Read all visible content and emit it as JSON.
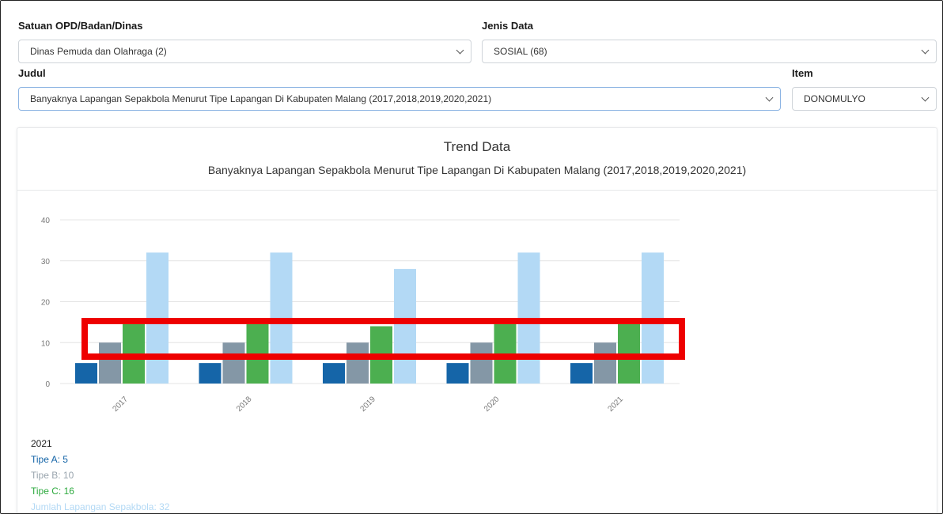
{
  "filters": {
    "satuan_label": "Satuan OPD/Badan/Dinas",
    "satuan_value": "Dinas Pemuda dan Olahraga (2)",
    "jenis_label": "Jenis Data",
    "jenis_value": "SOSIAL (68)",
    "judul_label": "Judul",
    "judul_value": "Banyaknya Lapangan Sepakbola Menurut Tipe Lapangan Di Kabupaten Malang (2017,2018,2019,2020,2021)",
    "item_label": "Item",
    "item_value": "DONOMULYO"
  },
  "card": {
    "title": "Trend Data",
    "subtitle": "Banyaknya Lapangan Sepakbola Menurut Tipe Lapangan Di Kabupaten Malang (2017,2018,2019,2020,2021)"
  },
  "chart_data": {
    "type": "bar",
    "categories": [
      "2017",
      "2018",
      "2019",
      "2020",
      "2021"
    ],
    "series": [
      {
        "name": "Tipe A",
        "values": [
          5,
          5,
          5,
          5,
          5
        ],
        "color": "#1565a8"
      },
      {
        "name": "Tipe B",
        "values": [
          10,
          10,
          10,
          10,
          10
        ],
        "color": "#8497a6"
      },
      {
        "name": "Tipe C",
        "values": [
          16,
          16,
          14,
          16,
          16
        ],
        "color": "#4caf50"
      },
      {
        "name": "Jumlah Lapangan Sepakbola",
        "values": [
          32,
          32,
          28,
          32,
          32
        ],
        "color": "#b3d9f5"
      }
    ],
    "ylim": [
      0,
      40
    ],
    "yticks": [
      0,
      10,
      20,
      30,
      40
    ],
    "grid": true,
    "highlight_color": "#ee0000"
  },
  "tooltip": {
    "title": "2021",
    "lines": [
      {
        "text": "Tipe A: 5",
        "color": "#1565a8"
      },
      {
        "text": "Tipe B: 10",
        "color": "#9aa5ae"
      },
      {
        "text": "Tipe C: 16",
        "color": "#2eaa3f"
      },
      {
        "text": "Jumlah Lapangan Sepakbola: 32",
        "color": "#b3d9f5"
      }
    ]
  }
}
